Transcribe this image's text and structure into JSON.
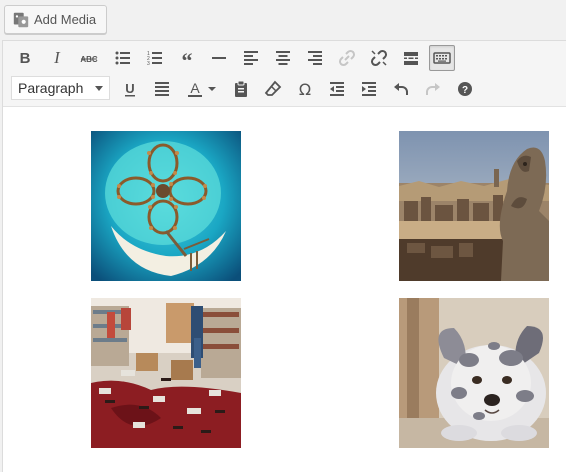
{
  "media": {
    "add_media_label": "Add Media"
  },
  "toolbar": {
    "row1": [
      "bold-button",
      "italic-button",
      "strikethrough-button",
      "bulleted-list-button",
      "numbered-list-button",
      "blockquote-button",
      "horizontal-line-button",
      "align-left-button",
      "align-center-button",
      "align-right-button",
      "insert-link-button",
      "remove-link-button",
      "read-more-button",
      "toolbar-toggle-button"
    ],
    "row2": [
      "underline-button",
      "justify-button",
      "text-color-button",
      "paste-as-text-button",
      "clear-formatting-button",
      "special-character-button",
      "outdent-button",
      "indent-button",
      "undo-button",
      "redo-button",
      "help-button"
    ],
    "format_select": {
      "value": "Paragraph"
    },
    "active": "toolbar-toggle-button",
    "disabled": [
      "insert-link-button",
      "redo-button"
    ]
  },
  "images": [
    {
      "name": "island-resort-image",
      "description": "aerial resort"
    },
    {
      "name": "paris-gargoyle-image",
      "description": "city view"
    },
    {
      "name": "store-aisle-image",
      "description": "broken bottles"
    },
    {
      "name": "puppy-image",
      "description": "puppy"
    }
  ],
  "colors": {
    "accent": "#0073aa",
    "toolbar_bg": "#f5f5f5",
    "icon": "#555555"
  }
}
